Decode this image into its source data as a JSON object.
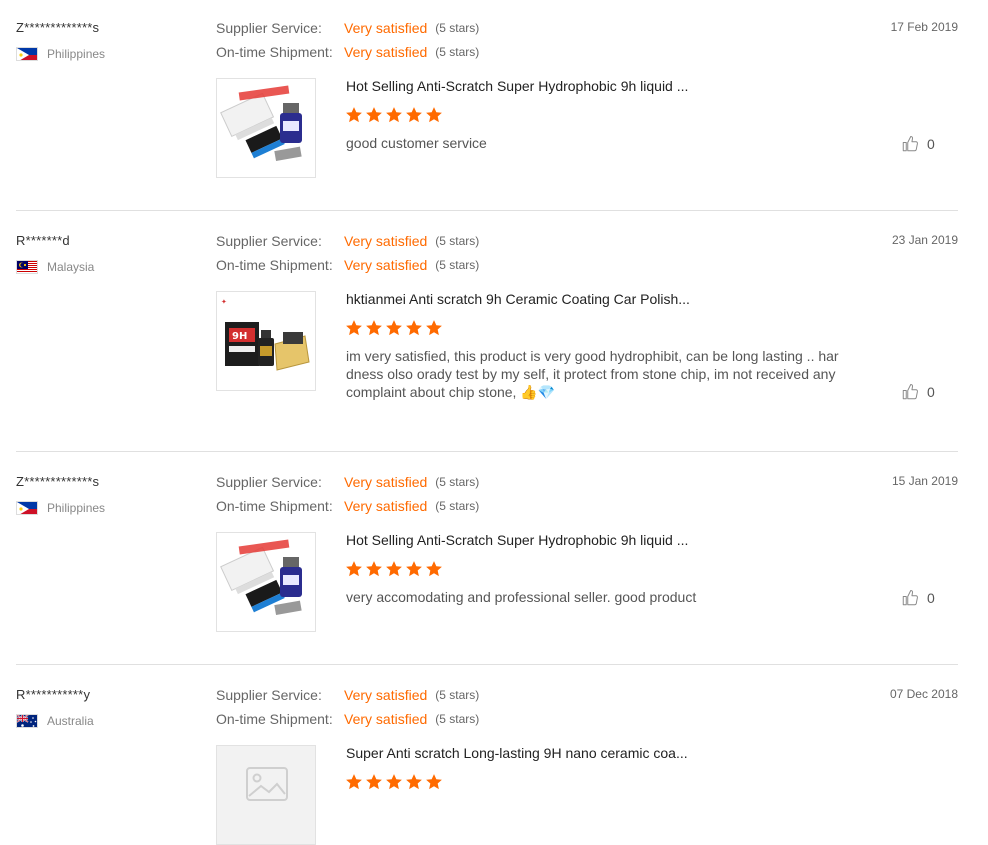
{
  "labels": {
    "supplier_service": "Supplier Service:",
    "ontime_shipment": "On-time Shipment:"
  },
  "colors": {
    "accent": "#ff6a00",
    "divider": "#e0e0e0"
  },
  "reviews": [
    {
      "buyer": "Z*************s",
      "country": "Philippines",
      "flag": "philippines",
      "date": "17 Feb 2019",
      "supplier_service": "Very satisfied",
      "supplier_service_stars": "(5 stars)",
      "ontime_shipment": "Very satisfied",
      "ontime_shipment_stars": "(5 stars)",
      "product_title": "Hot Selling Anti-Scratch Super Hydrophobic 9h liquid ...",
      "product_image": "ceramic-coating-kit-blue",
      "rating": 5,
      "text": "good customer service",
      "helpful_count": "0"
    },
    {
      "buyer": "R*******d",
      "country": "Malaysia",
      "flag": "malaysia",
      "date": "23 Jan 2019",
      "supplier_service": "Very satisfied",
      "supplier_service_stars": "(5 stars)",
      "ontime_shipment": "Very satisfied",
      "ontime_shipment_stars": "(5 stars)",
      "product_title": "hktianmei Anti scratch 9h Ceramic Coating Car Polish...",
      "product_image": "ceramic-coating-9h-kit",
      "rating": 5,
      "text": "im very satisfied, this product is very good hydrophibit, can be long lasting .. hardness olso orady test by my self, it protect from stone chip, im not received any complaint about chip stone,",
      "emojis": [
        "thumbs-up",
        "gem"
      ],
      "helpful_count": "0"
    },
    {
      "buyer": "Z*************s",
      "country": "Philippines",
      "flag": "philippines",
      "date": "15 Jan 2019",
      "supplier_service": "Very satisfied",
      "supplier_service_stars": "(5 stars)",
      "ontime_shipment": "Very satisfied",
      "ontime_shipment_stars": "(5 stars)",
      "product_title": "Hot Selling Anti-Scratch Super Hydrophobic 9h liquid ...",
      "product_image": "ceramic-coating-kit-blue",
      "rating": 5,
      "text": "very accomodating and professional seller. good product",
      "helpful_count": "0"
    },
    {
      "buyer": "R***********y",
      "country": "Australia",
      "flag": "australia",
      "date": "07 Dec 2018",
      "supplier_service": "Very satisfied",
      "supplier_service_stars": "(5 stars)",
      "ontime_shipment": "Very satisfied",
      "ontime_shipment_stars": "(5 stars)",
      "product_title": "Super Anti scratch Long-lasting 9H nano ceramic coa...",
      "product_image": "image-placeholder",
      "rating": 5
    }
  ]
}
